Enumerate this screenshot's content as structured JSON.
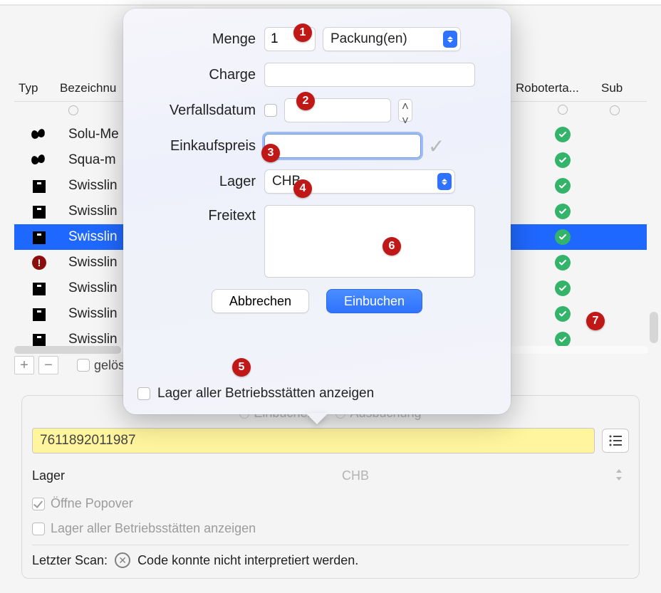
{
  "table": {
    "headers": {
      "typ": "Typ",
      "bezeichnung": "Bezeichnu",
      "roboter": "Roboterta...",
      "sub": "Sub"
    },
    "rows": [
      {
        "icon": "bean",
        "name": "Solu-Me",
        "robot": true,
        "selected": false
      },
      {
        "icon": "bean",
        "name": "Squa-m",
        "robot": true,
        "selected": false
      },
      {
        "icon": "box",
        "name": "Swisslin",
        "robot": true,
        "selected": false
      },
      {
        "icon": "box",
        "name": "Swisslin",
        "robot": true,
        "selected": false
      },
      {
        "icon": "box",
        "name": "Swisslin",
        "robot": true,
        "selected": true
      },
      {
        "icon": "alert",
        "name": "Swisslin",
        "robot": true,
        "selected": false
      },
      {
        "icon": "box",
        "name": "Swisslin",
        "robot": true,
        "selected": false
      },
      {
        "icon": "box",
        "name": "Swisslin",
        "robot": true,
        "selected": false
      },
      {
        "icon": "box",
        "name": "Swisslin",
        "robot": true,
        "selected": false
      }
    ]
  },
  "footer": {
    "deleted_label": "gelös"
  },
  "panel": {
    "mode_in": "Einbuchen",
    "mode_out": "Ausbuchung",
    "barcode": "7611892011987",
    "lager_label": "Lager",
    "lager_value": "CHB",
    "open_popover": "Öffne Popover",
    "show_all_sites": "Lager aller Betriebsstätten anzeigen",
    "last_scan_label": "Letzter Scan:",
    "last_scan_msg": "Code konnte nicht interpretiert werden."
  },
  "popover": {
    "menge_label": "Menge",
    "menge_value": "1",
    "unit": "Packung(en)",
    "charge_label": "Charge",
    "charge_value": "",
    "verfall_label": "Verfallsdatum",
    "verfall_value": "",
    "ek_label": "Einkaufspreis",
    "ek_value": "",
    "lager_label": "Lager",
    "lager_value": "CHB",
    "freitext_label": "Freitext",
    "freitext_value": "",
    "cancel": "Abbrechen",
    "submit": "Einbuchen",
    "show_all_sites": "Lager aller Betriebsstätten anzeigen"
  },
  "callouts": {
    "1": "1",
    "2": "2",
    "3": "3",
    "4": "4",
    "5": "5",
    "6": "6",
    "7": "7"
  }
}
